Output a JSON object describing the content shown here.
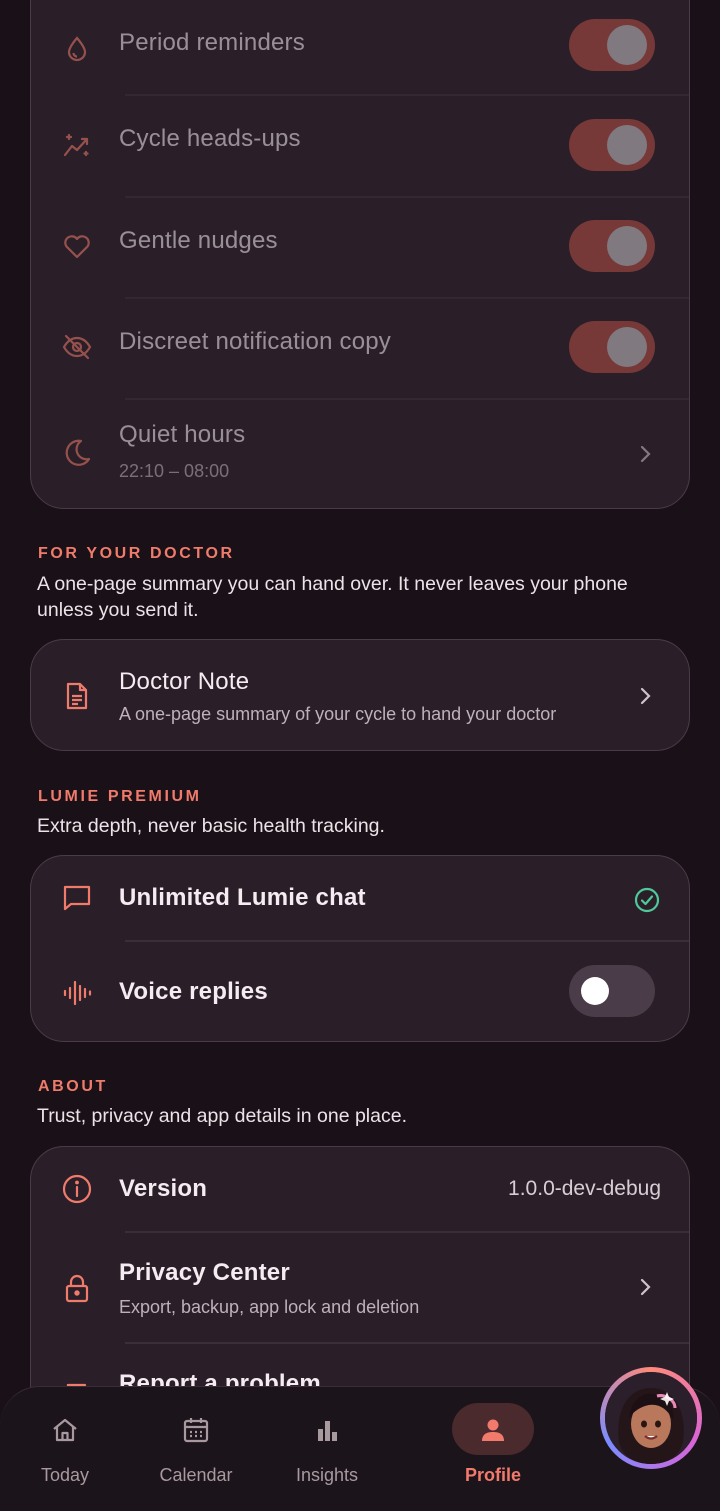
{
  "notifications": {
    "items": [
      {
        "label": "Period reminders",
        "icon": "drop-icon",
        "on": true
      },
      {
        "label": "Cycle heads-ups",
        "icon": "sparkle-trend-icon",
        "on": true
      },
      {
        "label": "Gentle nudges",
        "icon": "heart-icon",
        "on": true
      },
      {
        "label": "Discreet notification copy",
        "icon": "eye-off-icon",
        "on": true
      }
    ],
    "quiet_hours": {
      "label": "Quiet hours",
      "value": "22:10 – 08:00"
    }
  },
  "doctor": {
    "title": "FOR YOUR DOCTOR",
    "desc": "A one-page summary you can hand over. It never leaves your phone unless you send it.",
    "note_label": "Doctor Note",
    "note_sub": "A one-page summary of your cycle to hand your doctor"
  },
  "premium": {
    "title": "LUMIE PREMIUM",
    "desc": "Extra depth, never basic health tracking.",
    "chat_label": "Unlimited Lumie chat",
    "voice_label": "Voice replies",
    "voice_on": false
  },
  "about": {
    "title": "ABOUT",
    "desc": "Trust, privacy and app details in one place.",
    "version_label": "Version",
    "version_value": "1.0.0-dev-debug",
    "privacy_label": "Privacy Center",
    "privacy_sub": "Export, backup, app lock and deletion",
    "report_label": "Report a problem"
  },
  "nav": {
    "items": [
      {
        "label": "Today",
        "icon": "home-icon"
      },
      {
        "label": "Calendar",
        "icon": "calendar-icon"
      },
      {
        "label": "Insights",
        "icon": "bar-chart-icon"
      },
      {
        "label": "Profile",
        "icon": "person-icon"
      }
    ],
    "active": "Profile"
  },
  "colors": {
    "accent": "#f07b6b",
    "toggle_on": "#b64d45",
    "check": "#4fc99a",
    "background": "#1a1118",
    "card": "#2a1f29"
  }
}
